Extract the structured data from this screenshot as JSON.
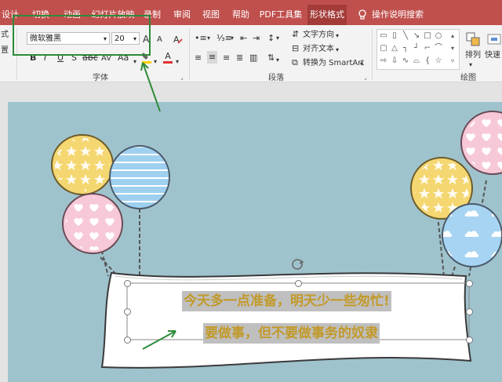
{
  "ribbon_tabs": [
    {
      "label": "设计"
    },
    {
      "label": "切换"
    },
    {
      "label": "动画"
    },
    {
      "label": "幻灯片放映"
    },
    {
      "label": "录制"
    },
    {
      "label": "审阅"
    },
    {
      "label": "视图"
    },
    {
      "label": "帮助"
    },
    {
      "label": "PDF工具集"
    },
    {
      "label": "形状格式"
    }
  ],
  "search_label": "操作说明搜索",
  "font": {
    "family": "微软雅黑",
    "size": "20",
    "group_label": "字体",
    "grow": "A",
    "shrink": "A",
    "bold": "B",
    "italic": "I",
    "underline": "U",
    "strike": "S",
    "spacing": "AV",
    "case": "Aa",
    "color_letter": "A"
  },
  "paragraph": {
    "group_label": "段落",
    "text_direction": "文字方向",
    "align_text": "对齐文本",
    "convert_smartart": "转换为 SmartArt"
  },
  "drawing": {
    "group_label": "绘图",
    "arrange": "排列",
    "quick_styles": "快速"
  },
  "left_stub": {
    "line1": "式",
    "line2": "置"
  },
  "slide": {
    "line1": "今天多一点准备，明天少一些匆忙!",
    "line2": "要做事，但不要做事务的奴隶"
  },
  "colors": {
    "accent": "#c0504d",
    "highlight_box": "#2e8b3a",
    "caption_text": "#c29a2a",
    "slide_bg": "#9fc3cd"
  }
}
